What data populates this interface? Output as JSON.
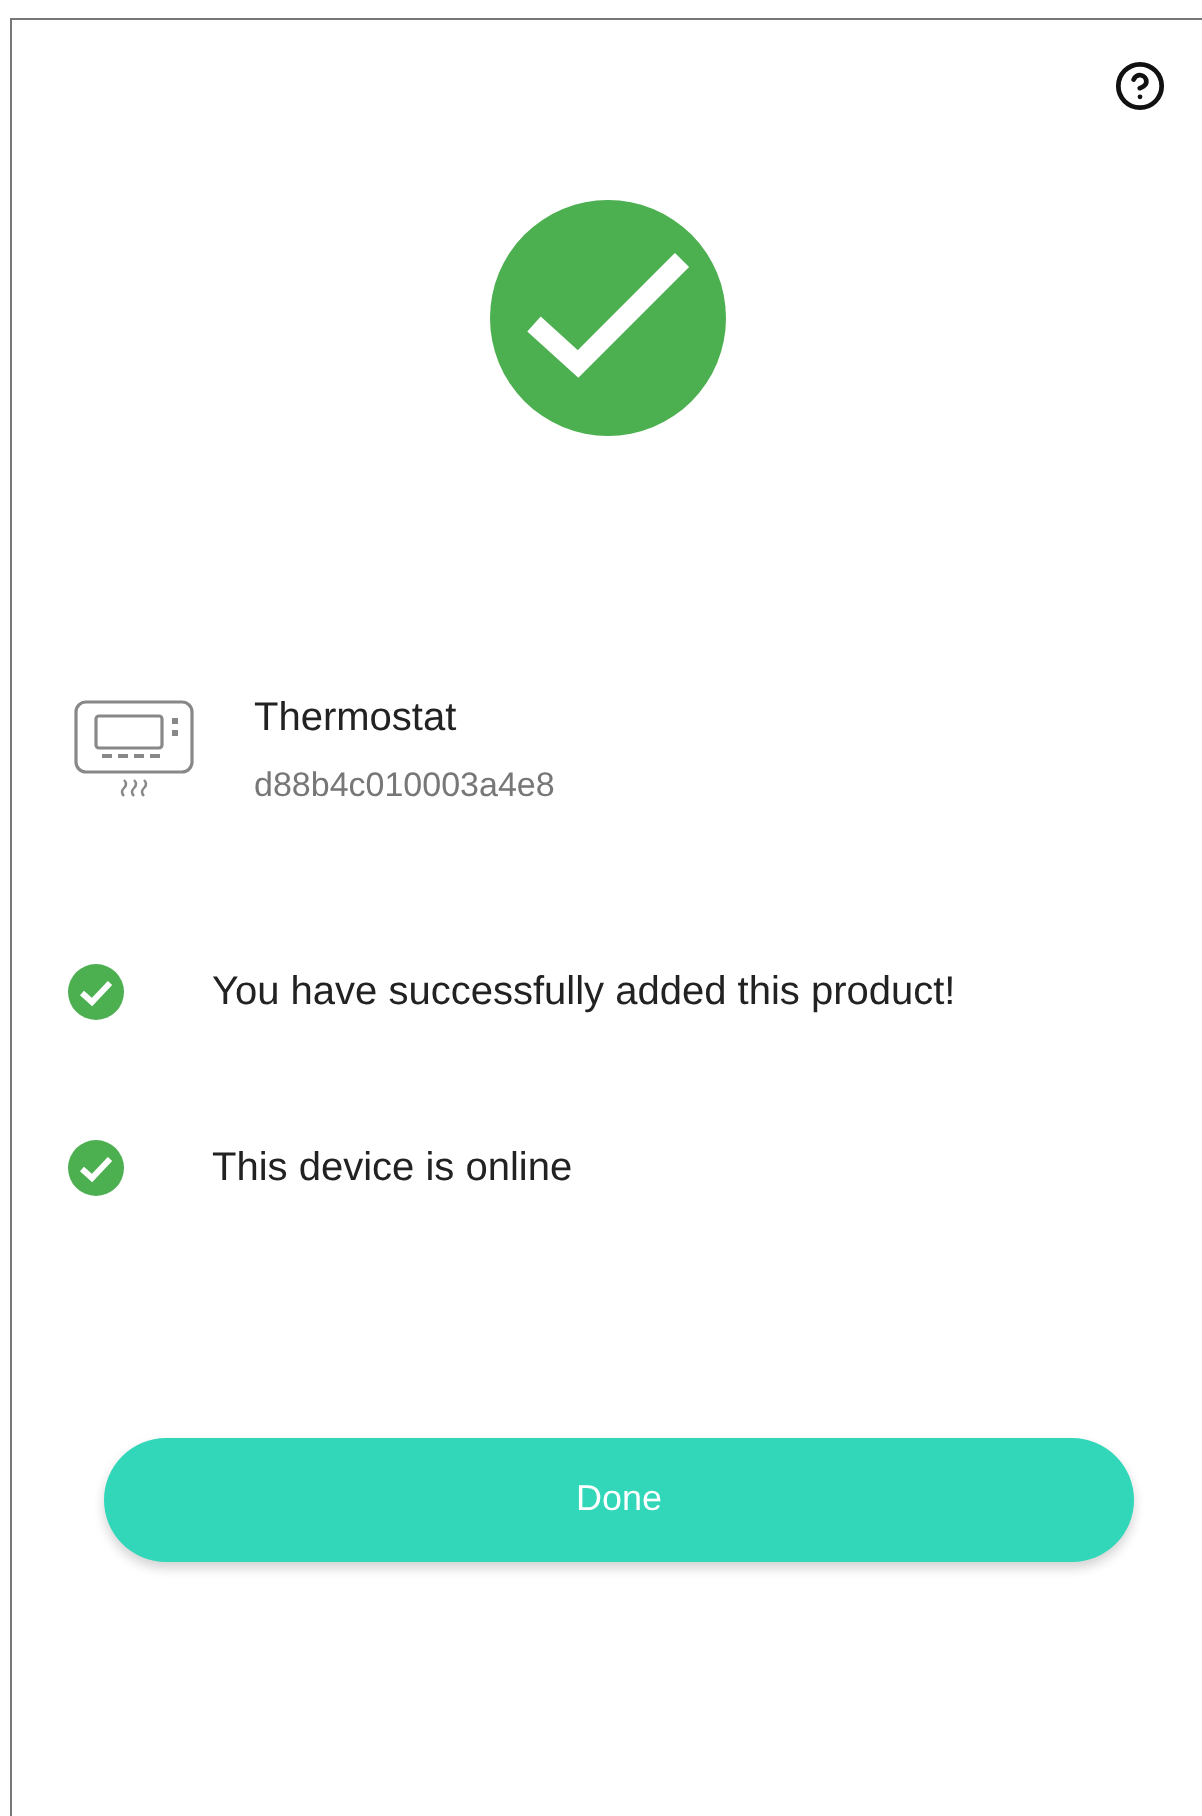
{
  "device": {
    "name": "Thermostat",
    "id": "d88b4c010003a4e8"
  },
  "checks": [
    {
      "text": "You have successfully added this product!"
    },
    {
      "text": "This device is online"
    }
  ],
  "done_button": {
    "label": "Done"
  }
}
